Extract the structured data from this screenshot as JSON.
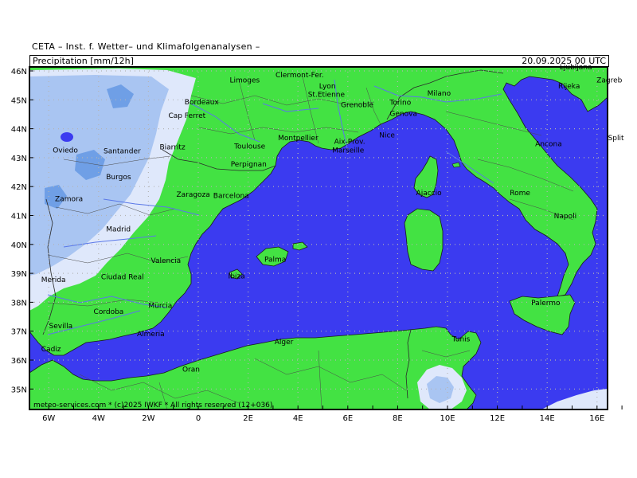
{
  "header": {
    "institute": "CETA – Inst. f. Wetter– und Klimafolgenanalysen –",
    "parameter": "Precipitation [mm/12h]",
    "valid_time": "20.09.2025  00 UTC"
  },
  "footer": "meteo-services.com * (c)2025 IWKF * All rights reserved (12+036)",
  "colors": {
    "sea": "#3b3bf0",
    "land": "#43e243",
    "precip_light": "#dfe8fb",
    "precip_mid": "#a9c5f2",
    "precip_heavy": "#6f9fe6",
    "border": "#3a3a3a",
    "river": "#5a78e8",
    "grid": "#b4b4b4"
  },
  "lat_labels": [
    "35N",
    "36N",
    "37N",
    "38N",
    "39N",
    "40N",
    "41N",
    "42N",
    "43N",
    "44N",
    "45N",
    "46N"
  ],
  "lon_labels": [
    "6W",
    "4W",
    "2W",
    "0",
    "2E",
    "4E",
    "6E",
    "8E",
    "10E",
    "12E",
    "14E",
    "16E"
  ],
  "cities": [
    {
      "name": "Clermont-Fer.",
      "lon": 3.1,
      "lat": 45.78
    },
    {
      "name": "Limoges",
      "lon": 1.26,
      "lat": 45.6
    },
    {
      "name": "Lyon",
      "lon": 4.85,
      "lat": 45.4
    },
    {
      "name": "St.Etienne",
      "lon": 4.4,
      "lat": 45.1
    },
    {
      "name": "Grenoble",
      "lon": 5.72,
      "lat": 44.75
    },
    {
      "name": "Torino",
      "lon": 7.68,
      "lat": 44.83
    },
    {
      "name": "Genova",
      "lon": 7.68,
      "lat": 44.45
    },
    {
      "name": "Milano",
      "lon": 9.19,
      "lat": 45.14
    },
    {
      "name": "Bordeaux",
      "lon": -0.55,
      "lat": 44.84
    },
    {
      "name": "Cap Ferret",
      "lon": -1.2,
      "lat": 44.38
    },
    {
      "name": "Montpellier",
      "lon": 3.2,
      "lat": 43.6
    },
    {
      "name": "Toulouse",
      "lon": 1.44,
      "lat": 43.32
    },
    {
      "name": "Nice",
      "lon": 7.26,
      "lat": 43.7
    },
    {
      "name": "Aix-Prov.",
      "lon": 5.45,
      "lat": 43.48
    },
    {
      "name": "Marseille",
      "lon": 5.37,
      "lat": 43.17
    },
    {
      "name": "Perpignan",
      "lon": 1.3,
      "lat": 42.7
    },
    {
      "name": "Biarritz",
      "lon": -1.55,
      "lat": 43.28
    },
    {
      "name": "Oviedo",
      "lon": -5.84,
      "lat": 43.18
    },
    {
      "name": "Santander",
      "lon": -3.8,
      "lat": 43.15
    },
    {
      "name": "Burgos",
      "lon": -3.7,
      "lat": 42.25
    },
    {
      "name": "Zamora",
      "lon": -5.75,
      "lat": 41.5
    },
    {
      "name": "Zaragoza",
      "lon": -0.88,
      "lat": 41.65
    },
    {
      "name": "Barcelona",
      "lon": 0.6,
      "lat": 41.6
    },
    {
      "name": "Madrid",
      "lon": -3.7,
      "lat": 40.45
    },
    {
      "name": "Valencia",
      "lon": -1.9,
      "lat": 39.36
    },
    {
      "name": "Palma",
      "lon": 2.65,
      "lat": 39.4
    },
    {
      "name": "Ibiza",
      "lon": 1.2,
      "lat": 38.83
    },
    {
      "name": "Merida",
      "lon": -6.3,
      "lat": 38.7
    },
    {
      "name": "Ciudad Real",
      "lon": -3.9,
      "lat": 38.8
    },
    {
      "name": "Murcia",
      "lon": -2.0,
      "lat": 37.8
    },
    {
      "name": "Cordoba",
      "lon": -4.2,
      "lat": 37.6
    },
    {
      "name": "Sevilla",
      "lon": -5.99,
      "lat": 37.1
    },
    {
      "name": "Almeria",
      "lon": -2.46,
      "lat": 36.83
    },
    {
      "name": "Cadiz",
      "lon": -6.3,
      "lat": 36.3
    },
    {
      "name": "Ajaccio",
      "lon": 8.74,
      "lat": 41.7
    },
    {
      "name": "Rome",
      "lon": 12.5,
      "lat": 41.7
    },
    {
      "name": "Napoli",
      "lon": 14.27,
      "lat": 40.9
    },
    {
      "name": "Ancona",
      "lon": 13.52,
      "lat": 43.4
    },
    {
      "name": "Split",
      "lon": 16.44,
      "lat": 43.6
    },
    {
      "name": "Zagreb",
      "lon": 15.98,
      "lat": 45.6
    },
    {
      "name": "Ljubljana",
      "lon": 14.5,
      "lat": 46.05
    },
    {
      "name": "Rijeka",
      "lon": 14.44,
      "lat": 45.4
    },
    {
      "name": "Palermo",
      "lon": 13.36,
      "lat": 37.9
    },
    {
      "name": "Tunis",
      "lon": 10.18,
      "lat": 36.65
    },
    {
      "name": "Alger",
      "lon": 3.06,
      "lat": 36.55
    },
    {
      "name": "Oran",
      "lon": -0.64,
      "lat": 35.6
    }
  ]
}
